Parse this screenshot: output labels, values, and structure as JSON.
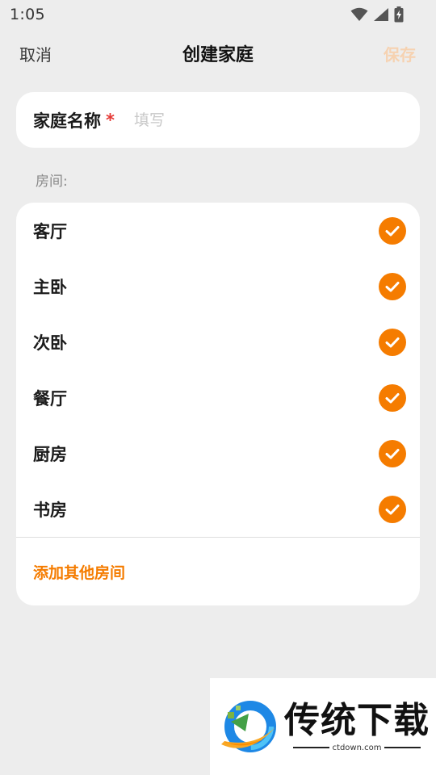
{
  "status_bar": {
    "time": "1:05",
    "icons": [
      "wifi-icon",
      "signal-icon",
      "battery-charging-icon"
    ]
  },
  "header": {
    "cancel_label": "取消",
    "title": "创建家庭",
    "save_label": "保存"
  },
  "family_name": {
    "label": "家庭名称",
    "required_mark": "*",
    "value": "",
    "placeholder": "填写"
  },
  "rooms_section": {
    "label": "房间:",
    "rooms": [
      {
        "label": "客厅",
        "checked": true
      },
      {
        "label": "主卧",
        "checked": true
      },
      {
        "label": "次卧",
        "checked": true
      },
      {
        "label": "餐厅",
        "checked": true
      },
      {
        "label": "厨房",
        "checked": true
      },
      {
        "label": "书房",
        "checked": true
      }
    ],
    "add_label": "添加其他房间"
  },
  "watermark": {
    "brand": "传统下载",
    "domain": "ctdown.com"
  },
  "colors": {
    "accent": "#f57c00",
    "save_disabled": "#f6d2b1",
    "background": "#ededed",
    "required": "#e53935"
  }
}
